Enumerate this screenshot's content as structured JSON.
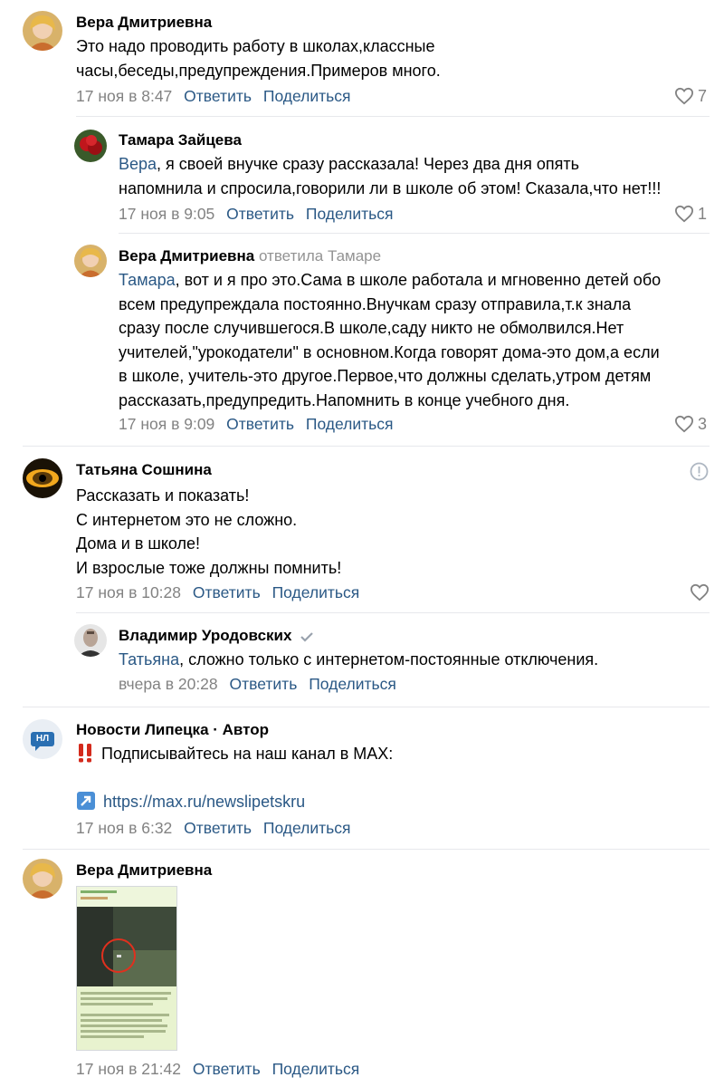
{
  "comments": [
    {
      "author": "Вера Дмитриевна",
      "text_lines": [
        "Это надо проводить работу в школах,классные",
        "часы,беседы,предупреждения.Примеров много."
      ],
      "date": "17 ноя в 8:47",
      "reply_label": "Ответить",
      "share_label": "Поделиться",
      "likes": "7"
    },
    {
      "author": "Тамара Зайцева",
      "mention": "Вера",
      "text_lines": [
        ", я своей внучке сразу рассказала! Через два дня опять",
        "напомнила и спросила,говорили ли в школе об этом! Сказала,что нет!!!"
      ],
      "date": "17 ноя в 9:05",
      "reply_label": "Ответить",
      "share_label": "Поделиться",
      "likes": "1"
    },
    {
      "author": "Вера Дмитриевна",
      "reply_to": "ответила Тамаре",
      "mention": "Тамара",
      "text_lines": [
        ", вот и я про это.Сама в школе работала и мгновенно детей обо",
        "всем предупреждала постоянно.Внучкам сразу отправила,т.к знала",
        "сразу после случившегося.В школе,саду никто не обмолвился.Нет",
        "учителей,\"урокодатели\" в основном.Когда говорят дома-это дом,а если",
        "в школе, учитель-это другое.Первое,что должны сделать,утром детям",
        "рассказать,предупредить.Напомнить в конце учебного дня."
      ],
      "date": "17 ноя в 9:09",
      "reply_label": "Ответить",
      "share_label": "Поделиться",
      "likes": "3"
    },
    {
      "author": "Татьяна Сошнина",
      "text_lines": [
        "Рассказать и показать!",
        "С интернетом это не сложно.",
        "Дома и в школе!",
        "И взрослые тоже должны помнить!"
      ],
      "date": "17 ноя в 10:28",
      "reply_label": "Ответить",
      "share_label": "Поделиться"
    },
    {
      "author": "Владимир Уродовских",
      "mention": "Татьяна",
      "text_lines": [
        ", сложно только с интернетом-постоянные отключения."
      ],
      "date": "вчера в 20:28",
      "reply_label": "Ответить",
      "share_label": "Поделиться"
    },
    {
      "author": "Новости Липецка · Автор",
      "avatar_text": "НЛ",
      "text_lines": [
        "Подписывайтесь на наш канал в MAX:"
      ],
      "link": "https://max.ru/newslipetskru",
      "date": "17 ноя в 6:32",
      "reply_label": "Ответить",
      "share_label": "Поделиться"
    },
    {
      "author": "Вера Дмитриевна",
      "date": "17 ноя в 21:42",
      "reply_label": "Ответить",
      "share_label": "Поделиться"
    }
  ],
  "colors": {
    "link": "#2a5885",
    "meta": "#828282",
    "separator": "#e7e8ec",
    "news_avatar_bg": "#e9eef4",
    "news_avatar_fg": "#2a6fb2"
  }
}
